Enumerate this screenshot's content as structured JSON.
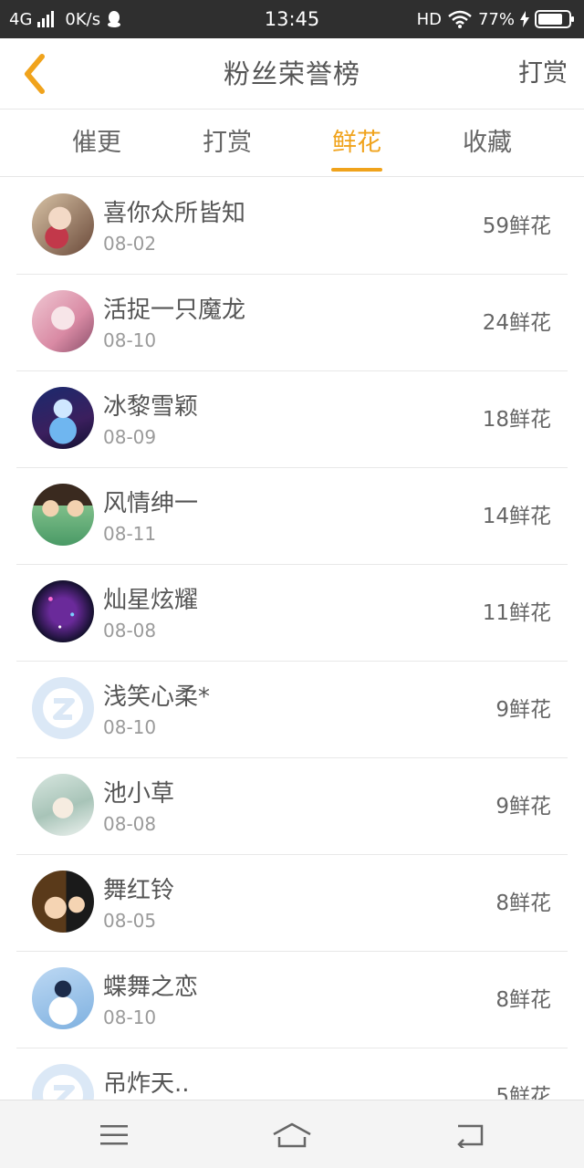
{
  "status_bar": {
    "network": "4G",
    "speed": "0K/s",
    "time": "13:45",
    "hd": "HD",
    "battery": "77%"
  },
  "header": {
    "title": "粉丝荣誉榜",
    "action_label": "打赏"
  },
  "tabs": [
    {
      "label": "催更",
      "active": false
    },
    {
      "label": "打赏",
      "active": false
    },
    {
      "label": "鲜花",
      "active": true
    },
    {
      "label": "收藏",
      "active": false
    }
  ],
  "fans": [
    {
      "name": "喜你众所皆知",
      "date": "08-02",
      "count": "59鲜花",
      "avatar": "anime-girl-red"
    },
    {
      "name": "活捉一只魔龙",
      "date": "08-10",
      "count": "24鲜花",
      "avatar": "anime-girl-pink"
    },
    {
      "name": "冰黎雪颖",
      "date": "08-09",
      "count": "18鲜花",
      "avatar": "anime-girl-blue"
    },
    {
      "name": "风情绅一",
      "date": "08-11",
      "count": "14鲜花",
      "avatar": "anime-two-kids"
    },
    {
      "name": "灿星炫耀",
      "date": "08-08",
      "count": "11鲜花",
      "avatar": "starry-galaxy"
    },
    {
      "name": "浅笑心柔*",
      "date": "08-10",
      "count": "9鲜花",
      "avatar": "default-avatar"
    },
    {
      "name": "池小草",
      "date": "08-08",
      "count": "9鲜花",
      "avatar": "anime-girl-green"
    },
    {
      "name": "舞红铃",
      "date": "08-05",
      "count": "8鲜花",
      "avatar": "anime-couple"
    },
    {
      "name": "蝶舞之恋",
      "date": "08-10",
      "count": "8鲜花",
      "avatar": "anime-girl-white"
    },
    {
      "name": "吊炸天..",
      "date": "",
      "count": "5鲜花",
      "avatar": "default-avatar"
    }
  ],
  "colors": {
    "accent": "#f0a31c",
    "status_bar_bg": "#2f2f2f",
    "nav_bg": "#f4f4f4"
  }
}
